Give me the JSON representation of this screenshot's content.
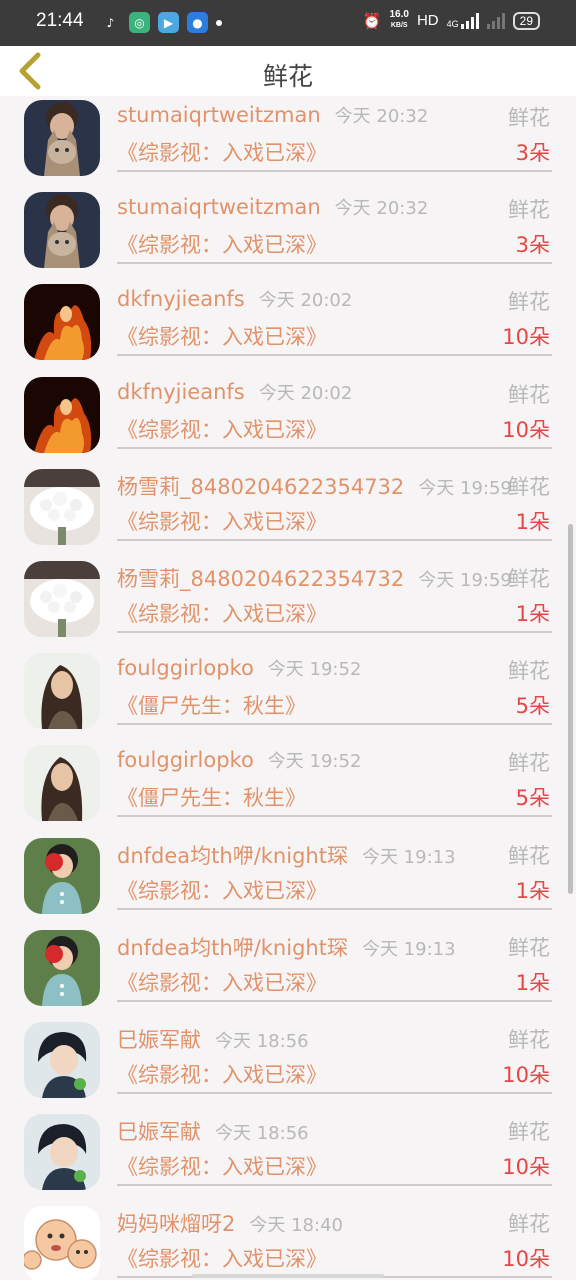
{
  "status_bar": {
    "time": "21:44",
    "speed_value": "16.0",
    "speed_unit": "KB/S",
    "hd": "HD",
    "network": "4G",
    "battery": "29"
  },
  "header": {
    "title": "鲜花"
  },
  "records": [
    {
      "name": "stumaiqrtweitzman",
      "time": "今天 20:32",
      "label": "鲜花",
      "work": "《综影视：入戏已深》",
      "count": "3朵",
      "avatar": "cat-icon"
    },
    {
      "name": "stumaiqrtweitzman",
      "time": "今天 20:32",
      "label": "鲜花",
      "work": "《综影视：入戏已深》",
      "count": "3朵",
      "avatar": "cat-icon"
    },
    {
      "name": "dkfnyjieanfs",
      "time": "今天 20:02",
      "label": "鲜花",
      "work": "《综影视：入戏已深》",
      "count": "10朵",
      "avatar": "fire-woman-icon"
    },
    {
      "name": "dkfnyjieanfs",
      "time": "今天 20:02",
      "label": "鲜花",
      "work": "《综影视：入戏已深》",
      "count": "10朵",
      "avatar": "fire-woman-icon"
    },
    {
      "name": "杨雪莉_8480204622354732",
      "time": "今天 19:59",
      "label": "鲜花",
      "work": "《综影视：入戏已深》",
      "count": "1朵",
      "avatar": "flower-bouquet-icon"
    },
    {
      "name": "杨雪莉_8480204622354732",
      "time": "今天 19:59",
      "label": "鲜花",
      "work": "《综影视：入戏已深》",
      "count": "1朵",
      "avatar": "flower-bouquet-icon"
    },
    {
      "name": "foulggirlopko",
      "time": "今天 19:52",
      "label": "鲜花",
      "work": "《僵尸先生：秋生》",
      "count": "5朵",
      "avatar": "woman-portrait-icon"
    },
    {
      "name": "foulggirlopko",
      "time": "今天 19:52",
      "label": "鲜花",
      "work": "《僵尸先生：秋生》",
      "count": "5朵",
      "avatar": "woman-portrait-icon"
    },
    {
      "name": "dnfdea均th咿/knight琛",
      "time": "今天 19:13",
      "label": "鲜花",
      "work": "《综影视：入戏已深》",
      "count": "1朵",
      "avatar": "child-flower-icon"
    },
    {
      "name": "dnfdea均th咿/knight琛",
      "time": "今天 19:13",
      "label": "鲜花",
      "work": "《综影视：入戏已深》",
      "count": "1朵",
      "avatar": "child-flower-icon"
    },
    {
      "name": "巳娠军献",
      "time": "今天 18:56",
      "label": "鲜花",
      "work": "《综影视：入戏已深》",
      "count": "10朵",
      "avatar": "boy-portrait-icon"
    },
    {
      "name": "巳娠军献",
      "time": "今天 18:56",
      "label": "鲜花",
      "work": "《综影视：入戏已深》",
      "count": "10朵",
      "avatar": "boy-portrait-icon"
    },
    {
      "name": "妈妈咪熘呀2",
      "time": "今天 18:40",
      "label": "鲜花",
      "work": "《综影视：入戏已深》",
      "count": "10朵",
      "avatar": "cartoon-faces-icon"
    }
  ]
}
